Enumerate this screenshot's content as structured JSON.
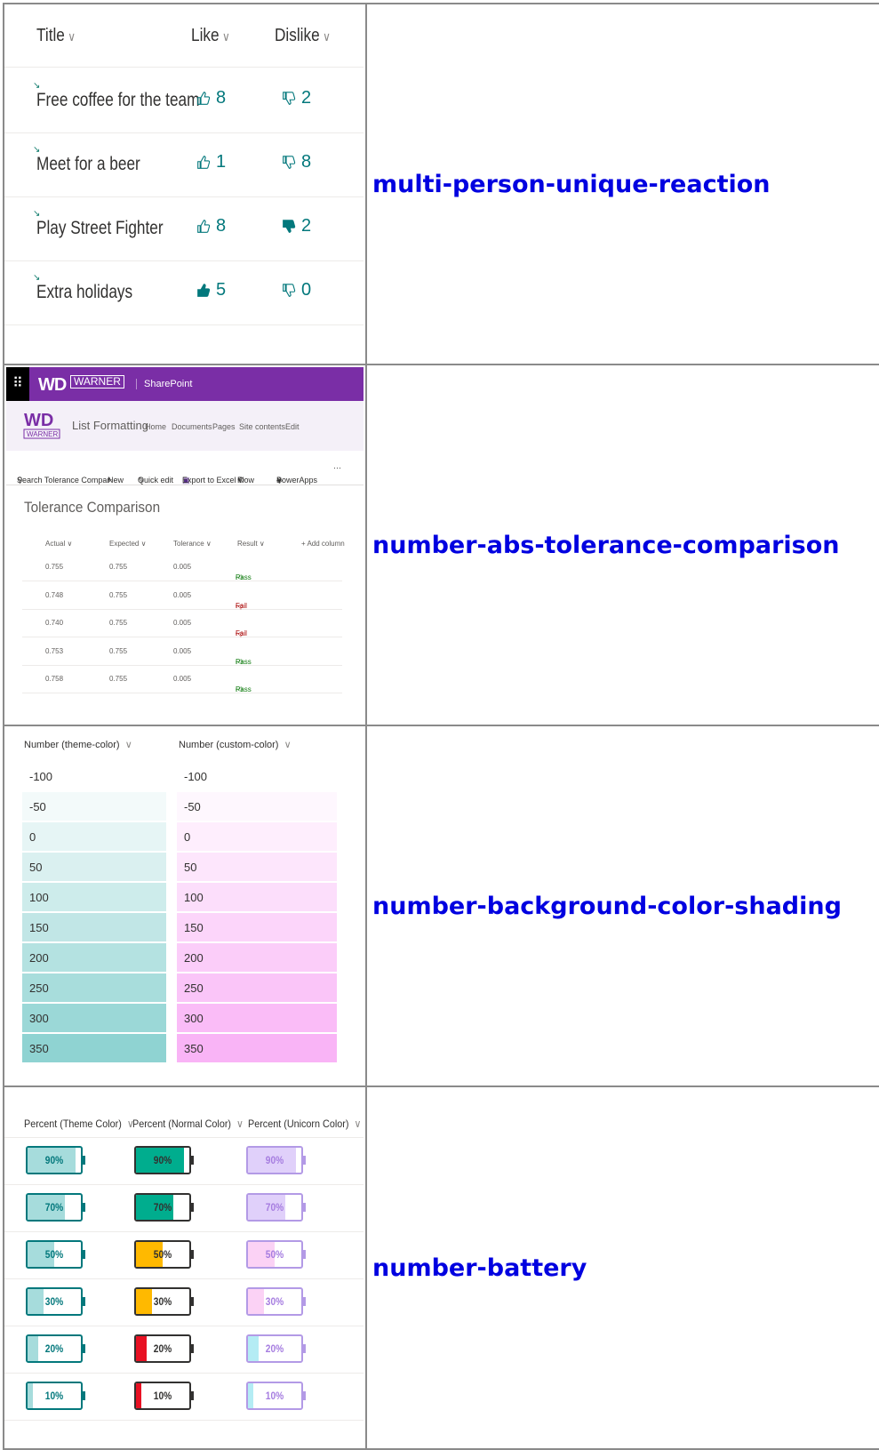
{
  "labels": [
    "multi-person-unique-reaction",
    "number-abs-tolerance-comparison",
    "number-background-color-shading",
    "number-battery"
  ],
  "reaction": {
    "headers": {
      "title": "Title",
      "like": "Like",
      "dislike": "Dislike"
    },
    "rows": [
      {
        "title": "Free coffee for the team",
        "like": "8",
        "dislike": "2",
        "liked": false,
        "disliked": false
      },
      {
        "title": "Meet for a beer",
        "like": "1",
        "dislike": "8",
        "liked": false,
        "disliked": false
      },
      {
        "title": "Play Street Fighter",
        "like": "8",
        "dislike": "2",
        "liked": false,
        "disliked": true
      },
      {
        "title": "Extra holidays",
        "like": "5",
        "dislike": "0",
        "liked": true,
        "disliked": false
      }
    ]
  },
  "tolerance": {
    "brand": "WARNER",
    "brand_sub": "DIGITAL",
    "app": "SharePoint",
    "site_title": "List Formatting",
    "nav": [
      "Home",
      "Documents",
      "Pages",
      "Site contents",
      "Edit"
    ],
    "commands": [
      "Search Tolerance Compar",
      "New",
      "Quick edit",
      "Export to Excel",
      "Flow",
      "PowerApps",
      "···"
    ],
    "list_title": "Tolerance Comparison",
    "headers": [
      "Actual",
      "Expected",
      "Tolerance",
      "Result",
      "Add column"
    ],
    "rows": [
      {
        "actual": "0.755",
        "expected": "0.755",
        "tolerance": "0.005",
        "result": "Pass"
      },
      {
        "actual": "0.748",
        "expected": "0.755",
        "tolerance": "0.005",
        "result": "Fail"
      },
      {
        "actual": "0.740",
        "expected": "0.755",
        "tolerance": "0.005",
        "result": "Fail"
      },
      {
        "actual": "0.753",
        "expected": "0.755",
        "tolerance": "0.005",
        "result": "Pass"
      },
      {
        "actual": "0.758",
        "expected": "0.755",
        "tolerance": "0.005",
        "result": "Pass"
      }
    ]
  },
  "shading": {
    "headers": [
      "Number (theme-color)",
      "Number (custom-color)"
    ],
    "values": [
      "-100",
      "-50",
      "0",
      "50",
      "100",
      "150",
      "200",
      "250",
      "300",
      "350"
    ],
    "theme_color": "#8fd3d2",
    "custom_color": "#f9b4f6"
  },
  "battery": {
    "headers": [
      "Percent (Theme Color)",
      "Percent (Normal Color)",
      "Percent (Unicorn Color)"
    ],
    "values": [
      90,
      70,
      50,
      30,
      20,
      10
    ],
    "labels": [
      "90%",
      "70%",
      "50%",
      "30%",
      "20%",
      "10%"
    ],
    "colors": {
      "theme_fill": "#a6dcdc",
      "theme_border": "#03787c",
      "theme_text": "#03787c",
      "normal_high": "#00ad8e",
      "normal_mid": "#ffb900",
      "normal_low": "#e81123",
      "normal_border": "#323130",
      "normal_text": "#323130",
      "unicorn_high": "#e0d0fa",
      "unicorn_mid": "#fbd2f5",
      "unicorn_low": "#b4ecf4",
      "unicorn_border": "#b39ae6",
      "unicorn_text": "#a67de0"
    }
  }
}
